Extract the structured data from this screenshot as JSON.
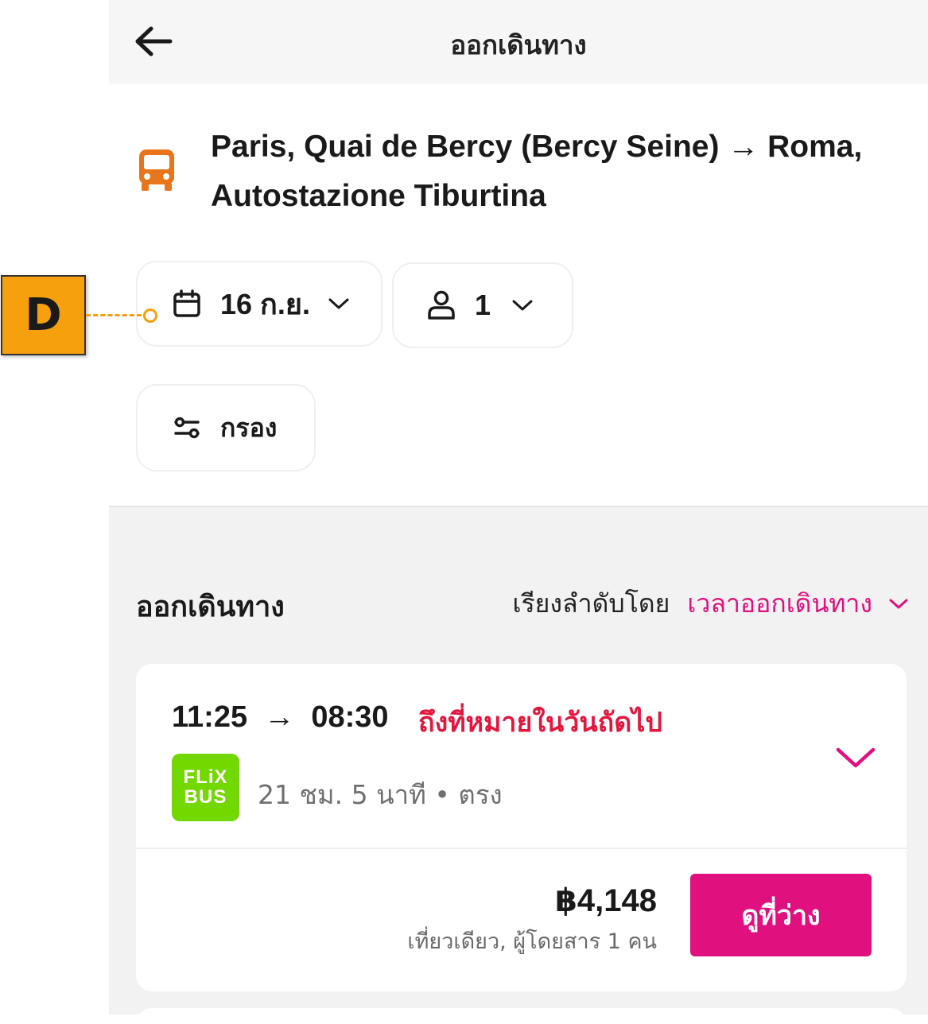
{
  "header": {
    "title": "ออกเดินทาง",
    "back_icon": "arrow-left-icon"
  },
  "route": {
    "icon": "bus-icon",
    "text": "Paris, Quai de Bercy (Bercy Seine) → Roma, Autostazione Tiburtina",
    "accent_color": "#e8741c"
  },
  "filters": {
    "date": {
      "icon": "calendar-icon",
      "label": "16 ก.ย."
    },
    "passengers": {
      "icon": "person-icon",
      "label": "1"
    },
    "filter": {
      "icon": "sliders-icon",
      "label": "กรอง"
    }
  },
  "results": {
    "title": "ออกเดินทาง",
    "sort_label": "เรียงลำดับโดย",
    "sort_value": "เวลาออกเดินทาง",
    "accent_color": "#e0107f"
  },
  "trip": {
    "times": "11:25  →  08:30",
    "next_day": "ถึงที่หมายในวันถัดไป",
    "operator_logo": {
      "line1": "FLiX",
      "line2": "BUS",
      "color": "#73d700"
    },
    "duration": "21 ชม. 5 นาที • ตรง",
    "price": "฿4,148",
    "price_note": "เที่ยวเดียว, ผู้โดยสาร 1 คน",
    "cta_label": "ดูที่ว่าง"
  },
  "annotation": {
    "label": "D"
  }
}
